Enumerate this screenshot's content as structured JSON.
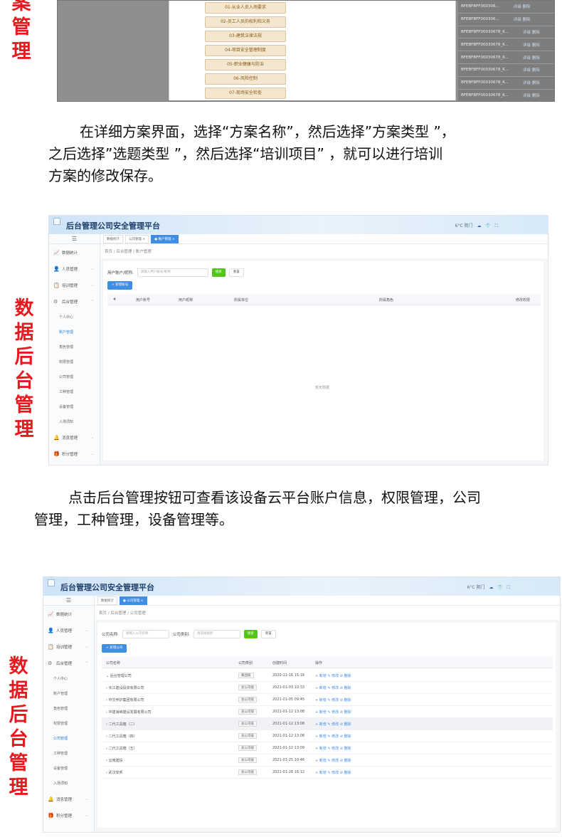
{
  "section1": {
    "red_label": [
      "案",
      "管",
      "理"
    ],
    "options": [
      "01-从业人员入场要求",
      "02-员工人员的权利和义务",
      "03-建筑法律法规",
      "04-项目安全管理制度",
      "05-职业健康与防治",
      "06-风险控制",
      "07-现场安全检查"
    ],
    "codes": [
      "BFEBFBFF000306...",
      "BFEBFBFF000306...",
      "BFEBFBFF00030678_K...",
      "BFEBFBFF00030678_K...",
      "BFEBFBFF00030678_K...",
      "BFEBFBFF00030678_K...",
      "BFEBFBFF00030678_K...",
      "BFEBFBFF00030678_K..."
    ],
    "row_actions": "评级 删除"
  },
  "paragraph1": [
    "在详细方案界面，选择“方案名称”，然后选择”方案类型 ”，",
    "之后选择”选题类型 ”，然后选择“培训项目” ，就可以进行培训",
    "方案的修改保存。"
  ],
  "label2": [
    "数",
    "据",
    "后",
    "台",
    "管",
    "理"
  ],
  "label3": [
    "数",
    "据",
    "后",
    "台",
    "管",
    "理"
  ],
  "app1": {
    "title": "后台管理公司安全管理平台",
    "weather": "6°C 阴门",
    "tabs": [
      "数据统计",
      "公司管理 ×",
      "● 账户管理 ×"
    ],
    "breadcrumb": "首页 / 后台管理 / 账户管理",
    "menus": [
      {
        "label": "数据统计",
        "icon": "chart-icon"
      },
      {
        "label": "人员管理",
        "icon": "user-icon"
      },
      {
        "label": "培训管理",
        "icon": "training-icon"
      },
      {
        "label": "后台管理",
        "icon": "admin-icon"
      }
    ],
    "submenus": [
      "个人中心",
      "账户管理",
      "角色管理",
      "权限管理",
      "公司管理",
      "工种管理",
      "设备管理",
      "入场须知"
    ],
    "bottom_menus": [
      "消息管理",
      "积分管理"
    ],
    "filter_label": "用户账户/昵称:",
    "filter_placeholder": "请输入用户账号/昵称",
    "search": "搜索",
    "reset": "重置",
    "add": "+ 新增账号",
    "columns": [
      "#",
      "用户账号",
      "用户昵称",
      "所属单位",
      "所属角色",
      "修改权限"
    ],
    "empty": "暂无数据"
  },
  "paragraph2": [
    "点击后台管理按钮可查看该设备云平台账户信息，权限管理，公司",
    "管理，工种管理，设备管理等。"
  ],
  "app2": {
    "title": "后台管理公司安全管理平台",
    "weather": "6°C 阴门",
    "tabs": [
      "数据统计",
      "● 公司管理 ×"
    ],
    "breadcrumb": "首页 / 后台管理 / 公司管理",
    "menus": [
      {
        "label": "数据统计",
        "icon": "chart-icon"
      },
      {
        "label": "人员管理",
        "icon": "user-icon"
      },
      {
        "label": "培训管理",
        "icon": "training-icon"
      },
      {
        "label": "后台管理",
        "icon": "admin-icon"
      }
    ],
    "submenus": [
      "个人中心",
      "账户管理",
      "角色管理",
      "权限管理",
      "公司管理",
      "工种管理",
      "设备管理",
      "入场须知"
    ],
    "bottom_menus": [
      "消息管理",
      "积分管理"
    ],
    "filter_label1": "公司名称:",
    "filter_placeholder1": "请输入公司名称",
    "filter_label2": "公司类别:",
    "filter_placeholder2": "请选择类别",
    "search": "搜索",
    "reset": "重置",
    "add": "+ 新增公司",
    "columns": [
      "公司名称",
      "公司类别",
      "创建时间",
      "操作"
    ],
    "rows": [
      {
        "name": "⌄ 后台管理公司",
        "type": "集团级",
        "time": "2020-11-16 15:16",
        "ops": "+ 新增  ✎ 修改  ⊘ 删除"
      },
      {
        "name": "› 长江建设投资有限公司",
        "type": "总公司级",
        "time": "2021-01-03 10:33",
        "ops": "+ 新增  ✎ 修改  ⊘ 删除"
      },
      {
        "name": "› 中交养护集团有限公司",
        "type": "总公司级",
        "time": "2021-01-05 09:45",
        "ops": "+ 新增  ✎ 修改  ⊘ 删除"
      },
      {
        "name": "› 中建海峡建设发展有限公司",
        "type": "总公司级",
        "time": "2021-01-12 13:08",
        "ops": "+ 新增  ✎ 修改  ⊘ 删除"
      },
      {
        "name": "› 二代工具箱（二）",
        "type": "总公司级",
        "time": "2021-01-12 13:08",
        "ops": "+ 新增  ✎ 修改  ⊘ 删除"
      },
      {
        "name": "› 二代工具箱（四）",
        "type": "总公司级",
        "time": "2021-01-12 13:08",
        "ops": "+ 新增  ✎ 修改  ⊘ 删除"
      },
      {
        "name": "› 二代工具箱（五）",
        "type": "总公司级",
        "time": "2021-01-12 13:09",
        "ops": "+ 新增  ✎ 修改  ⊘ 删除"
      },
      {
        "name": "› 云南建投",
        "type": "总公司级",
        "time": "2021-01-25 10:46",
        "ops": "+ 新增  ✎ 修改  ⊘ 删除"
      },
      {
        "name": "› 武汉安邦",
        "type": "总公司级",
        "time": "2021-01-26 16:12",
        "ops": "+ 新增  ✎ 修改  ⊘ 删除"
      }
    ]
  }
}
